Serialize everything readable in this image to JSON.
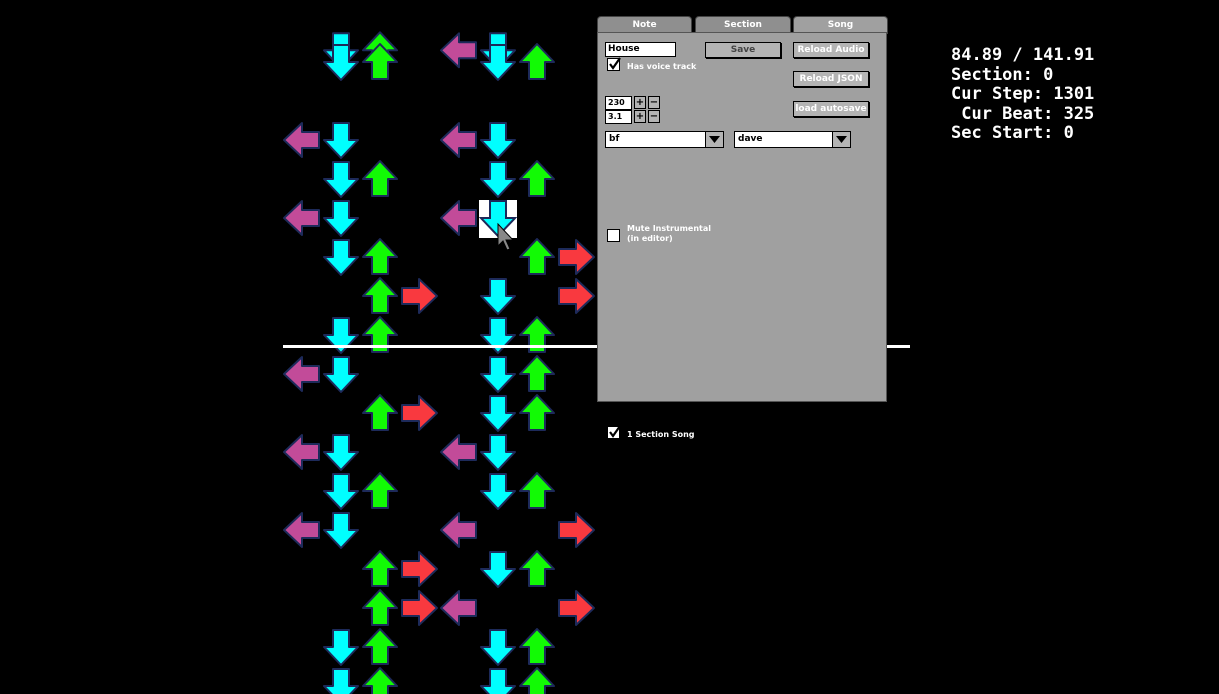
{
  "tabs": {
    "note": "Note",
    "section": "Section",
    "song": "Song",
    "active": "song"
  },
  "song_tab": {
    "song_name": "House",
    "save_label": "Save",
    "reload_audio_label": "Reload Audio",
    "reload_json_label": "Reload JSON",
    "load_autosave_label": "load autosave",
    "voice_track_label": "Has voice track",
    "voice_track_checked": true,
    "bpm": "230",
    "speed": "3.1",
    "player1": "bf",
    "player2": "dave",
    "mute_label_line1": "Mute Instrumental",
    "mute_label_line2": "(in editor)",
    "mute_checked": false
  },
  "section_song": {
    "label": "1 Section Song",
    "checked": true
  },
  "info": {
    "time": "84.89 / 141.91",
    "section": "Section: 0",
    "step": "Cur Step: 1301",
    "beat": " Cur Beat: 325",
    "sec_start": "Sec Start: 0"
  },
  "colors": {
    "left": "#c24b99",
    "down": "#00ffff",
    "up": "#12fa05",
    "right": "#f9393f"
  },
  "notes": [
    {
      "row": -0.3,
      "lane": 1
    },
    {
      "row": -0.3,
      "lane": 2
    },
    {
      "row": -0.3,
      "lane": 4
    },
    {
      "row": -0.3,
      "lane": 5
    },
    {
      "row": 0,
      "lane": 1
    },
    {
      "row": 0,
      "lane": 2
    },
    {
      "row": 0,
      "lane": 5
    },
    {
      "row": 0,
      "lane": 6
    },
    {
      "row": 2,
      "lane": 0
    },
    {
      "row": 2,
      "lane": 1
    },
    {
      "row": 2,
      "lane": 4
    },
    {
      "row": 2,
      "lane": 5
    },
    {
      "row": 3,
      "lane": 1
    },
    {
      "row": 3,
      "lane": 2
    },
    {
      "row": 3,
      "lane": 5
    },
    {
      "row": 3,
      "lane": 6
    },
    {
      "row": 4,
      "lane": 0
    },
    {
      "row": 4,
      "lane": 1
    },
    {
      "row": 4,
      "lane": 4
    },
    {
      "row": 4,
      "lane": 5
    },
    {
      "row": 5,
      "lane": 1
    },
    {
      "row": 5,
      "lane": 2
    },
    {
      "row": 5,
      "lane": 6
    },
    {
      "row": 5,
      "lane": 7
    },
    {
      "row": 6,
      "lane": 2
    },
    {
      "row": 6,
      "lane": 3
    },
    {
      "row": 6,
      "lane": 5
    },
    {
      "row": 6,
      "lane": 7
    },
    {
      "row": 7,
      "lane": 1
    },
    {
      "row": 7,
      "lane": 2
    },
    {
      "row": 7,
      "lane": 5
    },
    {
      "row": 7,
      "lane": 6
    },
    {
      "row": 8,
      "lane": 0
    },
    {
      "row": 8,
      "lane": 1
    },
    {
      "row": 8,
      "lane": 5
    },
    {
      "row": 8,
      "lane": 6
    },
    {
      "row": 9,
      "lane": 2
    },
    {
      "row": 9,
      "lane": 3
    },
    {
      "row": 9,
      "lane": 5
    },
    {
      "row": 9,
      "lane": 6
    },
    {
      "row": 10,
      "lane": 0
    },
    {
      "row": 10,
      "lane": 1
    },
    {
      "row": 10,
      "lane": 4
    },
    {
      "row": 10,
      "lane": 5
    },
    {
      "row": 11,
      "lane": 1
    },
    {
      "row": 11,
      "lane": 2
    },
    {
      "row": 11,
      "lane": 5
    },
    {
      "row": 11,
      "lane": 6
    },
    {
      "row": 12,
      "lane": 0
    },
    {
      "row": 12,
      "lane": 1
    },
    {
      "row": 12,
      "lane": 4
    },
    {
      "row": 12,
      "lane": 7
    },
    {
      "row": 13,
      "lane": 2
    },
    {
      "row": 13,
      "lane": 3
    },
    {
      "row": 13,
      "lane": 5
    },
    {
      "row": 13,
      "lane": 6
    },
    {
      "row": 14,
      "lane": 2
    },
    {
      "row": 14,
      "lane": 3
    },
    {
      "row": 14,
      "lane": 4
    },
    {
      "row": 14,
      "lane": 7
    },
    {
      "row": 15,
      "lane": 1
    },
    {
      "row": 15,
      "lane": 2
    },
    {
      "row": 15,
      "lane": 5
    },
    {
      "row": 15,
      "lane": 6
    },
    {
      "row": 16,
      "lane": 1
    },
    {
      "row": 16,
      "lane": 2
    },
    {
      "row": 16,
      "lane": 5
    },
    {
      "row": 16,
      "lane": 6
    }
  ]
}
